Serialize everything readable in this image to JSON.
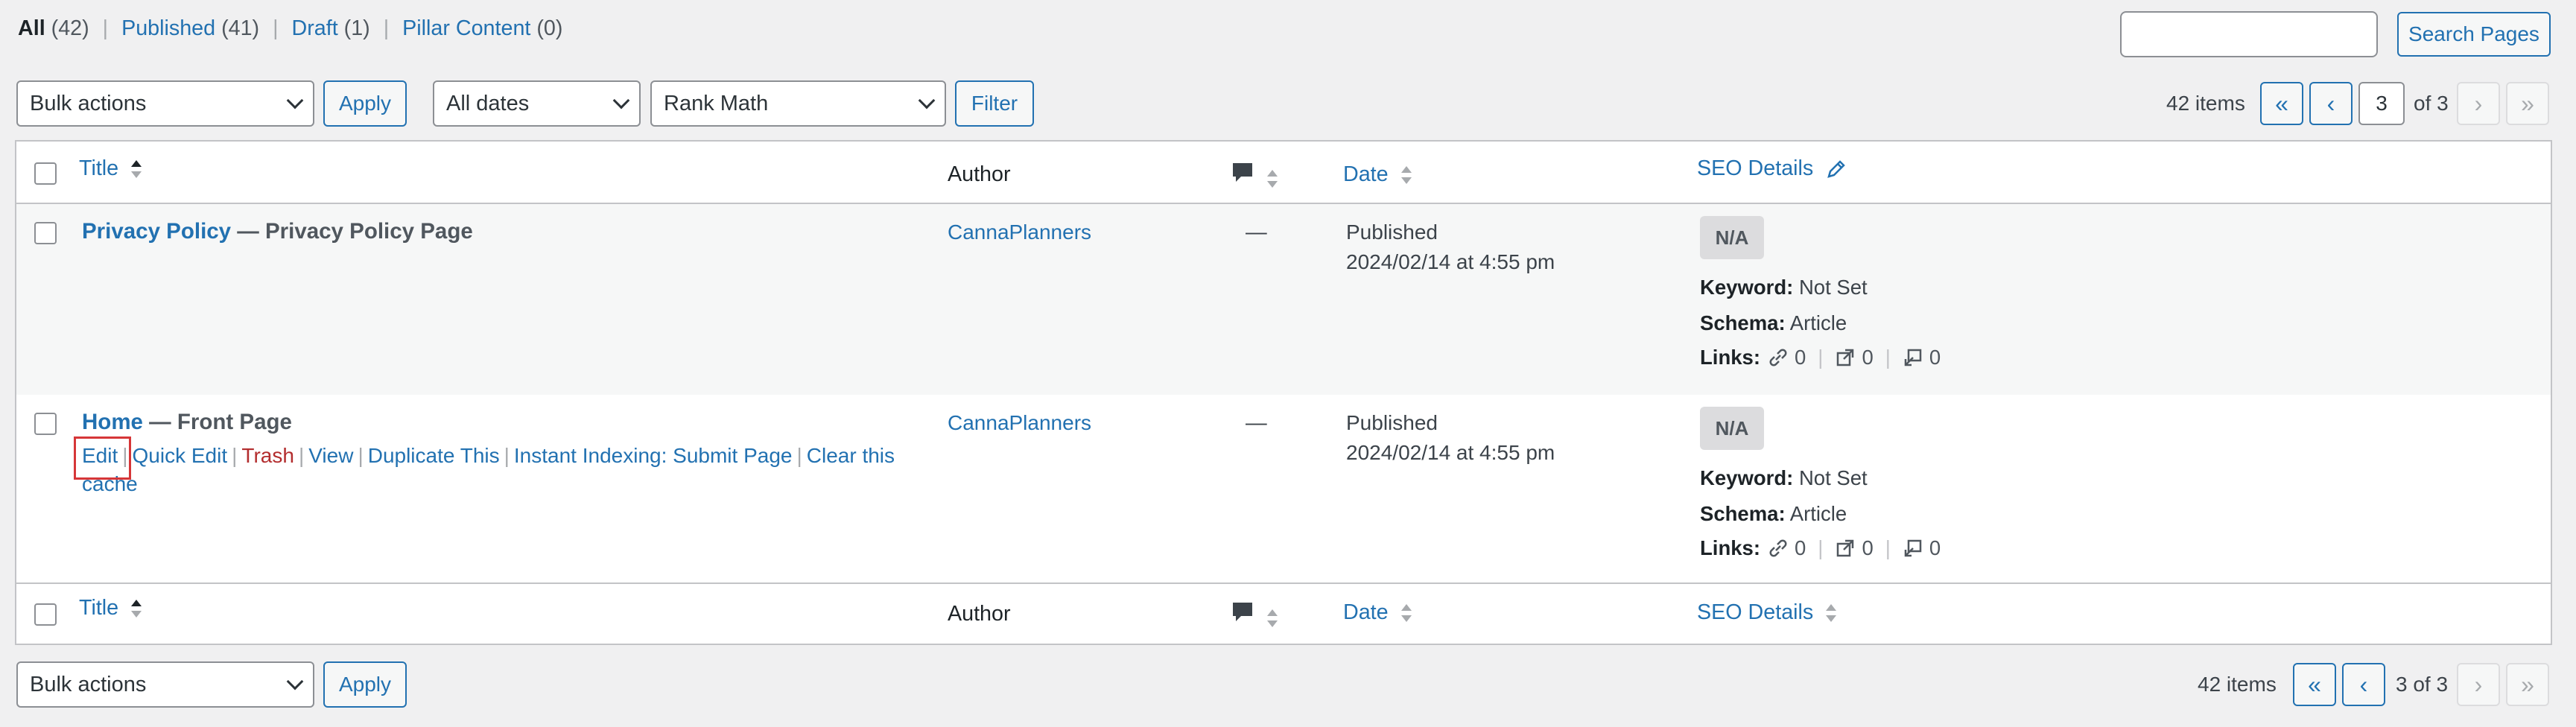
{
  "filters": {
    "all": "All",
    "all_count": "(42)",
    "published": "Published",
    "published_count": "(41)",
    "draft": "Draft",
    "draft_count": "(1)",
    "pillar": "Pillar Content",
    "pillar_count": "(0)",
    "separator": "|"
  },
  "search": {
    "value": "",
    "button": "Search Pages"
  },
  "top_nav": {
    "bulk_actions": "Bulk actions",
    "apply": "Apply",
    "dates": "All dates",
    "seo_filter": "Rank Math",
    "filter": "Filter",
    "items": "42 items",
    "first": "«",
    "prev": "‹",
    "current_page": "3",
    "of_pages": "of 3",
    "next": "›",
    "last": "»"
  },
  "columns": {
    "title": "Title",
    "author": "Author",
    "date": "Date",
    "seo": "SEO Details"
  },
  "rows": [
    {
      "title": "Privacy Policy",
      "state": " — Privacy Policy Page",
      "author": "CannaPlanners",
      "comments": "—",
      "status": "Published",
      "date": "2024/02/14 at 4:55 pm",
      "seo_score": "N/A",
      "keyword_label": "Keyword:",
      "keyword": "Not Set",
      "schema_label": "Schema:",
      "schema": "Article",
      "links_label": "Links:",
      "internal": "0",
      "external": "0",
      "incoming": "0"
    },
    {
      "title": "Home",
      "state": " — Front Page",
      "author": "CannaPlanners",
      "comments": "—",
      "status": "Published",
      "date": "2024/02/14 at 4:55 pm",
      "seo_score": "N/A",
      "keyword_label": "Keyword:",
      "keyword": "Not Set",
      "schema_label": "Schema:",
      "schema": "Article",
      "links_label": "Links:",
      "internal": "0",
      "external": "0",
      "incoming": "0",
      "actions": {
        "edit": "Edit",
        "quick_edit": "Quick Edit",
        "trash": "Trash",
        "view": "View",
        "duplicate": "Duplicate This",
        "indexing": "Instant Indexing: Submit Page",
        "clear_cache_1": "Clear this",
        "clear_cache_2": "cache",
        "separator": "|"
      }
    }
  ],
  "bottom_nav": {
    "bulk_actions": "Bulk actions",
    "apply": "Apply",
    "items": "42 items",
    "first": "«",
    "prev": "‹",
    "pages": "3 of 3",
    "next": "›",
    "last": "»"
  },
  "colors": {
    "link": "#2271b1",
    "trash": "#b32d2e",
    "highlight": "#d63638",
    "badge": "#dcdcde"
  }
}
